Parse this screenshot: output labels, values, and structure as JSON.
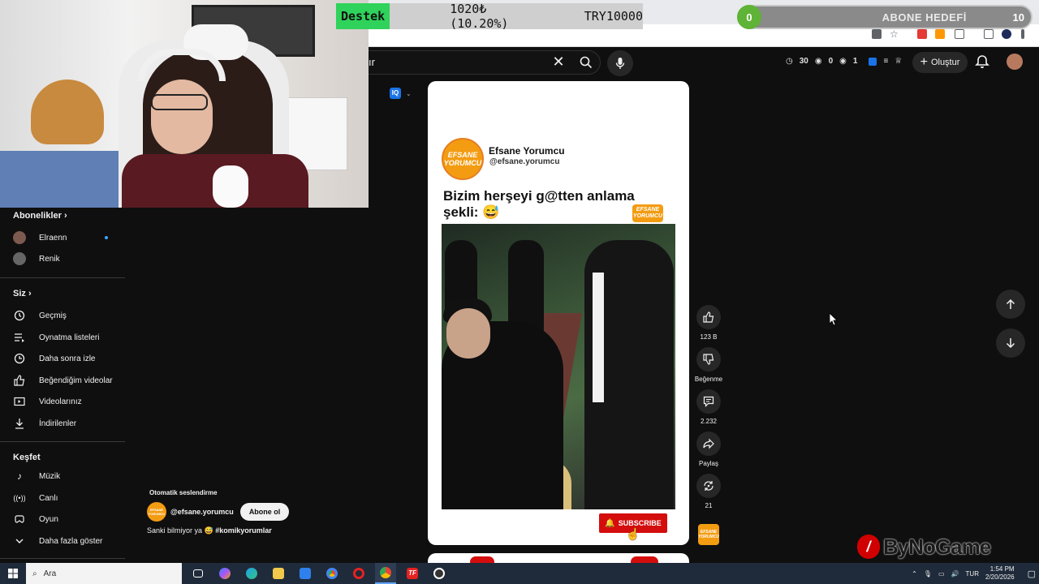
{
  "overlay": {
    "donation_tag": "Destek",
    "donation_amount": "1020₺ (10.20%)",
    "donation_goal": "TRY10000",
    "subgoal_current": "0",
    "subgoal_label": "ABONE HEDEFİ",
    "subgoal_target": "10"
  },
  "topbar": {
    "search_value": "ır",
    "stats": [
      "30",
      "0",
      "1"
    ],
    "create_label": "Oluştur"
  },
  "sidebar": {
    "subscriptions_title": "Abonelikler",
    "channels": [
      {
        "name": "Elraenn",
        "live": true
      },
      {
        "name": "Renik",
        "live": false
      }
    ],
    "you_title": "Siz",
    "you_items": [
      {
        "label": "Geçmiş",
        "icon": "history-icon"
      },
      {
        "label": "Oynatma listeleri",
        "icon": "playlist-icon"
      },
      {
        "label": "Daha sonra izle",
        "icon": "clock-icon"
      },
      {
        "label": "Beğendiğim videolar",
        "icon": "thumbs-up-icon"
      },
      {
        "label": "Videolarınız",
        "icon": "video-icon"
      },
      {
        "label": "İndirilenler",
        "icon": "download-icon"
      }
    ],
    "explore_title": "Keşfet",
    "explore_items": [
      {
        "label": "Müzik",
        "icon": "music-icon"
      },
      {
        "label": "Canlı",
        "icon": "live-icon"
      },
      {
        "label": "Oyun",
        "icon": "gaming-icon"
      },
      {
        "label": "Daha fazla göster",
        "icon": "chevron-down-icon"
      }
    ]
  },
  "short": {
    "channel_name": "Efsane Yorumcu",
    "channel_handle": "@efsane.yorumcu",
    "logo_text": "EFSANE YORUMCU",
    "caption": "Bizim herşeyi g@tten anlama şekli: 😅",
    "subscribe_label": "SUBSCRIBE"
  },
  "actions": {
    "like_count": "123 B",
    "dislike_label": "Beğenme",
    "comment_count": "2.232",
    "share_label": "Paylaş",
    "remix_count": "21"
  },
  "dub_panel": {
    "title": "Otomatik seslendirme",
    "handle": "@efsane.yorumcu",
    "subscribe_label": "Abone ol",
    "text": "Sanki bilmiyor ya 😅 ",
    "hashtag": "#komikyorumlar"
  },
  "watermark": {
    "brand": "ByNoGame"
  },
  "taskbar": {
    "search_placeholder": "Ara",
    "language": "TUR",
    "time": "1:54 PM",
    "date": "2/20/2026"
  },
  "colors": {
    "yt_bg": "#0f0f0f",
    "subscribe_red": "#d40d0d",
    "brand_orange": "#f39c12",
    "goal_green": "#5fb336"
  }
}
